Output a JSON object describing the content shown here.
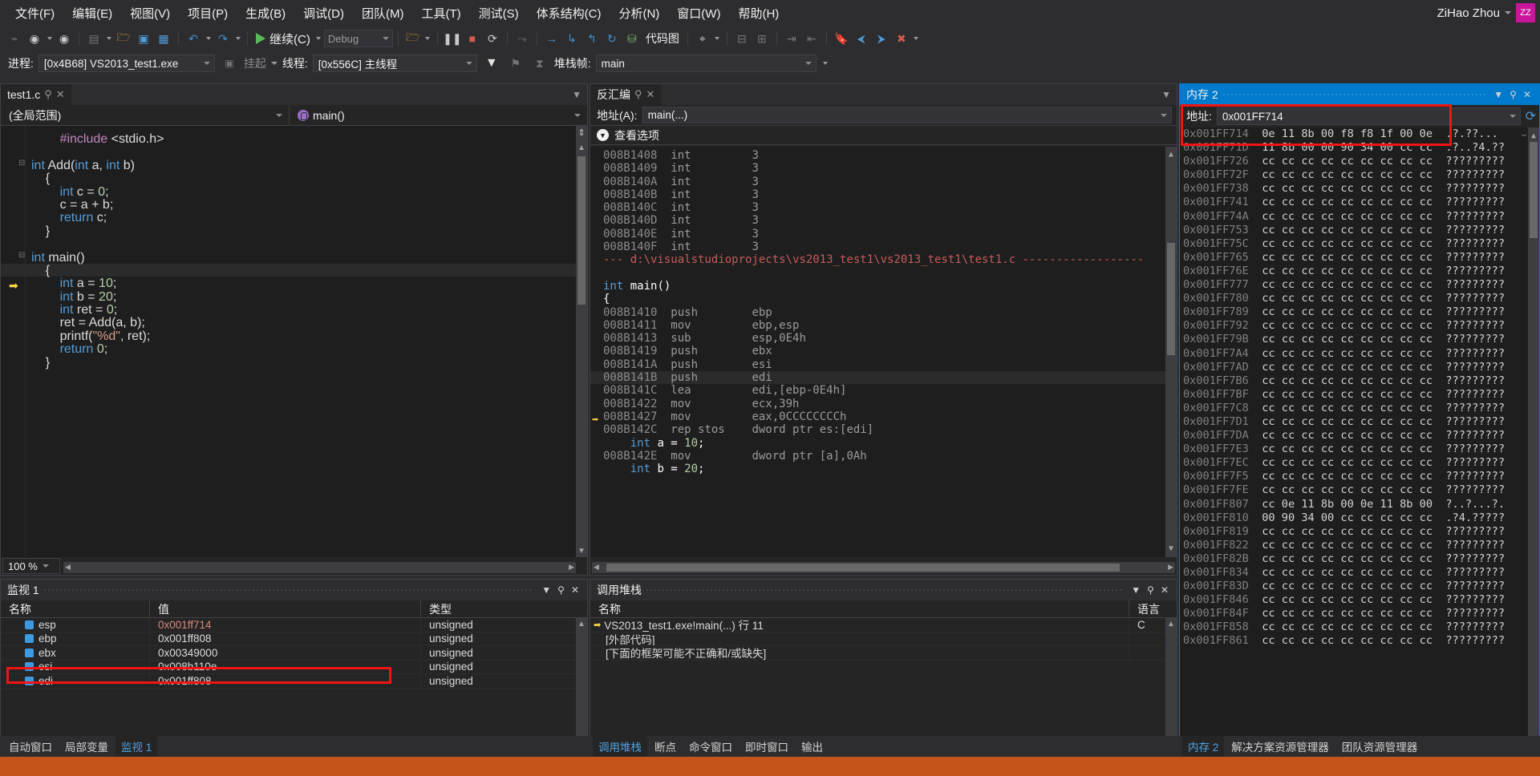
{
  "menu": {
    "items": [
      "文件(F)",
      "编辑(E)",
      "视图(V)",
      "项目(P)",
      "生成(B)",
      "调试(D)",
      "团队(M)",
      "工具(T)",
      "测试(S)",
      "体系结构(C)",
      "分析(N)",
      "窗口(W)",
      "帮助(H)"
    ],
    "user": "ZiHao Zhou",
    "avatar_initials": "ZZ"
  },
  "toolbar": {
    "continue_label": "继续(C)",
    "config_label": "Debug",
    "code_map_label": "代码图"
  },
  "debugbar": {
    "process_label": "进程:",
    "process_value": "[0x4B68] VS2013_test1.exe",
    "suspend_label": "挂起",
    "thread_label": "线程:",
    "thread_value": "[0x556C] 主线程",
    "frame_label": "堆栈帧:",
    "frame_value": "main"
  },
  "editor": {
    "tab_title": "test1.c",
    "scope_value": "(全局范围)",
    "member_value": "main()",
    "zoom_level": "100 %",
    "lines": [
      {
        "indent": 2,
        "text": "#include <stdio.h>"
      },
      {
        "indent": 0,
        "text": ""
      },
      {
        "indent": 0,
        "text": "int Add(int a, int b)",
        "fold": true
      },
      {
        "indent": 1,
        "text": "{"
      },
      {
        "indent": 2,
        "text": "int c = 0;"
      },
      {
        "indent": 2,
        "text": "c = a + b;"
      },
      {
        "indent": 2,
        "text": "return c;"
      },
      {
        "indent": 1,
        "text": "}"
      },
      {
        "indent": 0,
        "text": ""
      },
      {
        "indent": 0,
        "text": "int main()",
        "fold": true
      },
      {
        "indent": 1,
        "text": "{",
        "current": true
      },
      {
        "indent": 2,
        "text": "int a = 10;"
      },
      {
        "indent": 2,
        "text": "int b = 20;"
      },
      {
        "indent": 2,
        "text": "int ret = 0;"
      },
      {
        "indent": 2,
        "text": "ret = Add(a, b);"
      },
      {
        "indent": 2,
        "text": "printf(\"%d\", ret);"
      },
      {
        "indent": 2,
        "text": "return 0;"
      },
      {
        "indent": 1,
        "text": "}"
      }
    ]
  },
  "disassembly": {
    "tab_title": "反汇编",
    "address_label": "地址(A):",
    "address_value": "main(...)",
    "view_options_label": "查看选项",
    "rows": [
      {
        "addr": "008B1408",
        "op": "int",
        "arg": "3"
      },
      {
        "addr": "008B1409",
        "op": "int",
        "arg": "3"
      },
      {
        "addr": "008B140A",
        "op": "int",
        "arg": "3"
      },
      {
        "addr": "008B140B",
        "op": "int",
        "arg": "3"
      },
      {
        "addr": "008B140C",
        "op": "int",
        "arg": "3"
      },
      {
        "addr": "008B140D",
        "op": "int",
        "arg": "3"
      },
      {
        "addr": "008B140E",
        "op": "int",
        "arg": "3"
      },
      {
        "addr": "008B140F",
        "op": "int",
        "arg": "3"
      },
      {
        "kind": "path",
        "text": "--- d:\\visualstudioprojects\\vs2013_test1\\vs2013_test1\\test1.c ------------------"
      },
      {
        "kind": "blank",
        "text": ""
      },
      {
        "kind": "src",
        "text": "int main()"
      },
      {
        "kind": "src",
        "text": "{"
      },
      {
        "addr": "008B1410",
        "op": "push",
        "arg": "ebp"
      },
      {
        "addr": "008B1411",
        "op": "mov",
        "arg": "ebp,esp"
      },
      {
        "addr": "008B1413",
        "op": "sub",
        "arg": "esp,0E4h"
      },
      {
        "addr": "008B1419",
        "op": "push",
        "arg": "ebx"
      },
      {
        "addr": "008B141A",
        "op": "push",
        "arg": "esi"
      },
      {
        "addr": "008B141B",
        "op": "push",
        "arg": "edi",
        "current": true
      },
      {
        "addr": "008B141C",
        "op": "lea",
        "arg": "edi,[ebp-0E4h]"
      },
      {
        "addr": "008B1422",
        "op": "mov",
        "arg": "ecx,39h"
      },
      {
        "addr": "008B1427",
        "op": "mov",
        "arg": "eax,0CCCCCCCCh"
      },
      {
        "addr": "008B142C",
        "op": "rep stos",
        "arg": "dword ptr es:[edi]"
      },
      {
        "kind": "src",
        "text": "    int a = 10;"
      },
      {
        "addr": "008B142E",
        "op": "mov",
        "arg": "dword ptr [a],0Ah"
      },
      {
        "kind": "src",
        "text": "    int b = 20;"
      }
    ]
  },
  "memory": {
    "tab_title": "内存 2",
    "address_label": "地址:",
    "address_value": "0x001FF714",
    "rows": [
      {
        "addr": "0x001FF714",
        "bytes": "0e 11 8b 00 f8 f8 1f 00 0e",
        "ascii": ".?.??..."
      },
      {
        "addr": "0x001FF71D",
        "bytes": "11 8b 00 00 90 34 00 cc cc",
        "ascii": ".?..?4.??"
      },
      {
        "addr": "0x001FF726",
        "bytes": "cc cc cc cc cc cc cc cc cc",
        "ascii": "?????????"
      },
      {
        "addr": "0x001FF72F",
        "bytes": "cc cc cc cc cc cc cc cc cc",
        "ascii": "?????????"
      },
      {
        "addr": "0x001FF738",
        "bytes": "cc cc cc cc cc cc cc cc cc",
        "ascii": "?????????"
      },
      {
        "addr": "0x001FF741",
        "bytes": "cc cc cc cc cc cc cc cc cc",
        "ascii": "?????????"
      },
      {
        "addr": "0x001FF74A",
        "bytes": "cc cc cc cc cc cc cc cc cc",
        "ascii": "?????????"
      },
      {
        "addr": "0x001FF753",
        "bytes": "cc cc cc cc cc cc cc cc cc",
        "ascii": "?????????"
      },
      {
        "addr": "0x001FF75C",
        "bytes": "cc cc cc cc cc cc cc cc cc",
        "ascii": "?????????"
      },
      {
        "addr": "0x001FF765",
        "bytes": "cc cc cc cc cc cc cc cc cc",
        "ascii": "?????????"
      },
      {
        "addr": "0x001FF76E",
        "bytes": "cc cc cc cc cc cc cc cc cc",
        "ascii": "?????????"
      },
      {
        "addr": "0x001FF777",
        "bytes": "cc cc cc cc cc cc cc cc cc",
        "ascii": "?????????"
      },
      {
        "addr": "0x001FF780",
        "bytes": "cc cc cc cc cc cc cc cc cc",
        "ascii": "?????????"
      },
      {
        "addr": "0x001FF789",
        "bytes": "cc cc cc cc cc cc cc cc cc",
        "ascii": "?????????"
      },
      {
        "addr": "0x001FF792",
        "bytes": "cc cc cc cc cc cc cc cc cc",
        "ascii": "?????????"
      },
      {
        "addr": "0x001FF79B",
        "bytes": "cc cc cc cc cc cc cc cc cc",
        "ascii": "?????????"
      },
      {
        "addr": "0x001FF7A4",
        "bytes": "cc cc cc cc cc cc cc cc cc",
        "ascii": "?????????"
      },
      {
        "addr": "0x001FF7AD",
        "bytes": "cc cc cc cc cc cc cc cc cc",
        "ascii": "?????????"
      },
      {
        "addr": "0x001FF7B6",
        "bytes": "cc cc cc cc cc cc cc cc cc",
        "ascii": "?????????"
      },
      {
        "addr": "0x001FF7BF",
        "bytes": "cc cc cc cc cc cc cc cc cc",
        "ascii": "?????????"
      },
      {
        "addr": "0x001FF7C8",
        "bytes": "cc cc cc cc cc cc cc cc cc",
        "ascii": "?????????"
      },
      {
        "addr": "0x001FF7D1",
        "bytes": "cc cc cc cc cc cc cc cc cc",
        "ascii": "?????????"
      },
      {
        "addr": "0x001FF7DA",
        "bytes": "cc cc cc cc cc cc cc cc cc",
        "ascii": "?????????"
      },
      {
        "addr": "0x001FF7E3",
        "bytes": "cc cc cc cc cc cc cc cc cc",
        "ascii": "?????????"
      },
      {
        "addr": "0x001FF7EC",
        "bytes": "cc cc cc cc cc cc cc cc cc",
        "ascii": "?????????"
      },
      {
        "addr": "0x001FF7F5",
        "bytes": "cc cc cc cc cc cc cc cc cc",
        "ascii": "?????????"
      },
      {
        "addr": "0x001FF7FE",
        "bytes": "cc cc cc cc cc cc cc cc cc",
        "ascii": "?????????"
      },
      {
        "addr": "0x001FF807",
        "bytes": "cc 0e 11 8b 00 0e 11 8b 00",
        "ascii": "?..?...?."
      },
      {
        "addr": "0x001FF810",
        "bytes": "00 90 34 00 cc cc cc cc cc",
        "ascii": ".?4.?????"
      },
      {
        "addr": "0x001FF819",
        "bytes": "cc cc cc cc cc cc cc cc cc",
        "ascii": "?????????"
      },
      {
        "addr": "0x001FF822",
        "bytes": "cc cc cc cc cc cc cc cc cc",
        "ascii": "?????????"
      },
      {
        "addr": "0x001FF82B",
        "bytes": "cc cc cc cc cc cc cc cc cc",
        "ascii": "?????????"
      },
      {
        "addr": "0x001FF834",
        "bytes": "cc cc cc cc cc cc cc cc cc",
        "ascii": "?????????"
      },
      {
        "addr": "0x001FF83D",
        "bytes": "cc cc cc cc cc cc cc cc cc",
        "ascii": "?????????"
      },
      {
        "addr": "0x001FF846",
        "bytes": "cc cc cc cc cc cc cc cc cc",
        "ascii": "?????????"
      },
      {
        "addr": "0x001FF84F",
        "bytes": "cc cc cc cc cc cc cc cc cc",
        "ascii": "?????????"
      },
      {
        "addr": "0x001FF858",
        "bytes": "cc cc cc cc cc cc cc cc cc",
        "ascii": "?????????"
      },
      {
        "addr": "0x001FF861",
        "bytes": "cc cc cc cc cc cc cc cc cc",
        "ascii": "?????????"
      }
    ]
  },
  "watch": {
    "title": "监视 1",
    "columns": [
      "名称",
      "值",
      "类型"
    ],
    "rows": [
      {
        "name": "esp",
        "value": "0x001ff714",
        "type": "unsigned",
        "value_changed": true
      },
      {
        "name": "ebp",
        "value": "0x001ff808",
        "type": "unsigned"
      },
      {
        "name": "ebx",
        "value": "0x00349000",
        "type": "unsigned"
      },
      {
        "name": "esi",
        "value": "0x008b110e",
        "type": "unsigned",
        "highlighted": true
      },
      {
        "name": "edi",
        "value": "0x001ff808",
        "type": "unsigned"
      }
    ]
  },
  "callstack": {
    "title": "调用堆栈",
    "columns": [
      "名称",
      "语言"
    ],
    "rows": [
      {
        "name": "VS2013_test1.exe!main(...) 行 11",
        "lang": "C",
        "current": true
      },
      {
        "name": "[外部代码]",
        "lang": ""
      },
      {
        "name": "[下面的框架可能不正确和/或缺失]",
        "lang": ""
      }
    ]
  },
  "bottom_tabs": {
    "left": [
      {
        "label": "自动窗口",
        "selected": false
      },
      {
        "label": "局部变量",
        "selected": false
      },
      {
        "label": "监视 1",
        "selected": true
      }
    ],
    "center": [
      {
        "label": "调用堆栈",
        "selected": true
      },
      {
        "label": "断点",
        "selected": false
      },
      {
        "label": "命令窗口",
        "selected": false
      },
      {
        "label": "即时窗口",
        "selected": false
      },
      {
        "label": "输出",
        "selected": false
      }
    ],
    "right": [
      {
        "label": "内存 2",
        "selected": true
      },
      {
        "label": "解决方案资源管理器",
        "selected": false
      },
      {
        "label": "团队资源管理器",
        "selected": false
      }
    ]
  }
}
